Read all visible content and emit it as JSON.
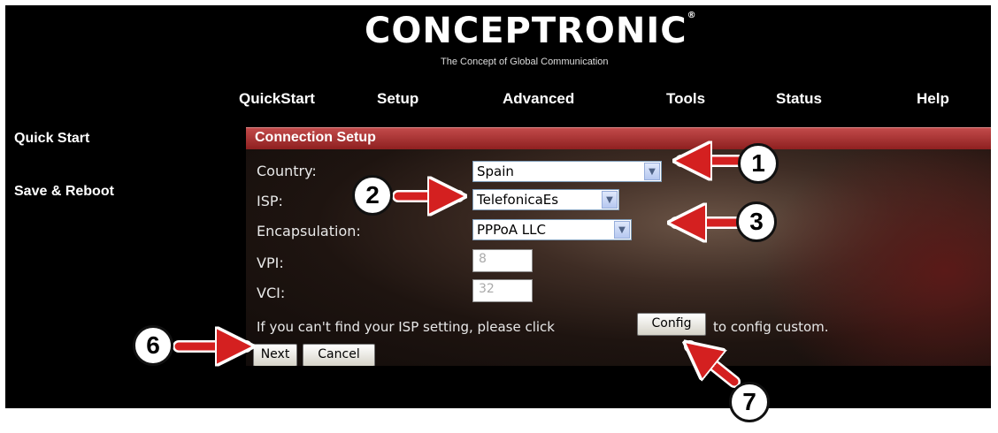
{
  "header": {
    "logo": "CONCEPTRONIC",
    "logo_mark": "®",
    "tagline": "The Concept of Global Communication"
  },
  "nav": [
    "QuickStart",
    "Setup",
    "Advanced",
    "Tools",
    "Status",
    "Help"
  ],
  "sidebar": {
    "items": [
      {
        "label": "Quick Start"
      },
      {
        "label": "Save & Reboot"
      }
    ]
  },
  "section": {
    "title": "Connection Setup"
  },
  "form": {
    "country": {
      "label": "Country:",
      "value": "Spain"
    },
    "isp": {
      "label": "ISP:",
      "value": "TelefonicaEs"
    },
    "encapsulation": {
      "label": "Encapsulation:",
      "value": "PPPoA LLC"
    },
    "vpi": {
      "label": "VPI:",
      "value": "8"
    },
    "vci": {
      "label": "VCI:",
      "value": "32"
    },
    "message_before": "If you can't find your ISP setting, please click",
    "config_button": "Config",
    "message_after": "to config custom.",
    "next_button": "Next",
    "cancel_button": "Cancel"
  },
  "callouts": [
    "1",
    "2",
    "3",
    "6",
    "7"
  ],
  "colors": {
    "section_bar": "#b03333",
    "background": "#000000",
    "arrow": "#d42020"
  }
}
